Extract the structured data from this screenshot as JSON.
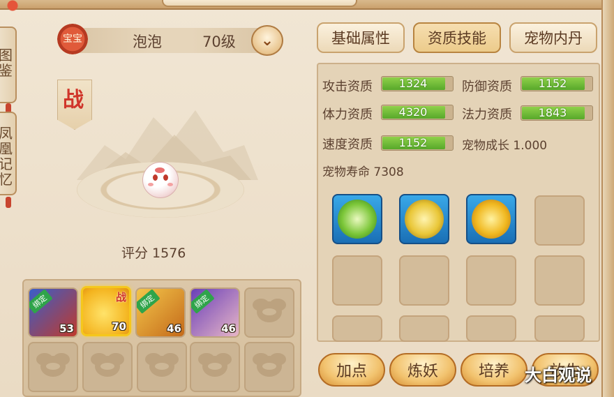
{
  "side_tabs": [
    "图鉴",
    "凤凰记忆"
  ],
  "pet_header": {
    "badge": "宝宝",
    "name": "泡泡",
    "level": "70级"
  },
  "battle_banner": "战",
  "score": "评分 1576",
  "pet_slots": [
    {
      "bound": "绑定",
      "level": "53"
    },
    {
      "level": "70",
      "battle": "战",
      "selected": true
    },
    {
      "bound": "绑定",
      "level": "46"
    },
    {
      "bound": "绑定",
      "level": "46"
    }
  ],
  "tabs": [
    {
      "label": "基础属性"
    },
    {
      "label": "资质技能",
      "active": true
    },
    {
      "label": "宠物内丹"
    }
  ],
  "attributes": [
    {
      "label": "攻击资质",
      "value": "1324",
      "fill": 0.87
    },
    {
      "label": "防御资质",
      "value": "1152",
      "fill": 0.87
    },
    {
      "label": "体力资质",
      "value": "4320",
      "fill": 0.87
    },
    {
      "label": "法力资质",
      "value": "1843",
      "fill": 0.87
    },
    {
      "label": "速度资质",
      "value": "1152",
      "fill": 0.87
    }
  ],
  "growth": "宠物成长 1.000",
  "lifespan": "宠物寿命 7308",
  "skills": [
    "wind-blade-skill-icon",
    "golden-sword-skill-icon",
    "golden-guardian-skill-icon"
  ],
  "buttons": {
    "add_points": "加点",
    "refine": "炼妖",
    "cultivate": "培养",
    "fourth": "放生"
  },
  "watermark": "大白观说"
}
